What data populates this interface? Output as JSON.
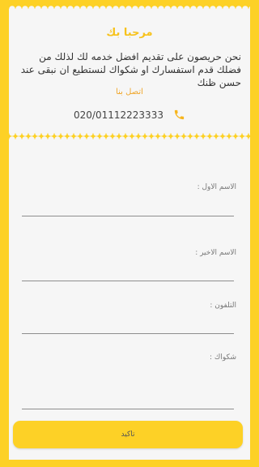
{
  "colors": {
    "background_frame": "#fdd126",
    "card": "#f6f6f6",
    "accent_title": "#f7c21b",
    "link": "#f0a72c",
    "phone_icon": "#f7b51c"
  },
  "header": {
    "welcome": "مرحبا بك",
    "intro": "نحن حريصون على تقديم افضل خدمه لك لذلك من فضلك قدم استفسارك او شكواك لنستطيع ان نبقى عند حسن ظنك",
    "contact_link": "اتصل بنا",
    "phone_number": "020/01112223333",
    "phone_icon": "phone-icon"
  },
  "form": {
    "first_name_label": "الاسم الاول :",
    "first_name_value": "",
    "last_name_label": "الاسم الاخير :",
    "last_name_value": "",
    "phone_label": "التلفون :",
    "phone_value": "",
    "complaint_label": "شكواك :",
    "complaint_value": "",
    "submit_label": "تاكيد"
  }
}
